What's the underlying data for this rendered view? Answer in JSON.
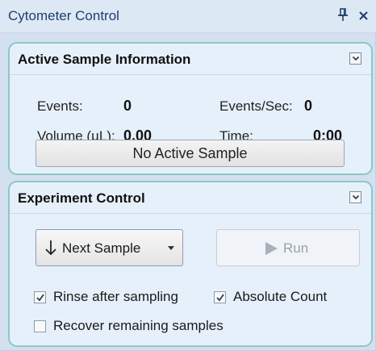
{
  "window": {
    "title": "Cytometer Control",
    "pin_icon": "pin-icon",
    "close_icon": "close-icon"
  },
  "active_sample": {
    "title": "Active Sample Information",
    "events_label": "Events:",
    "events_value": "0",
    "events_per_sec_label": "Events/Sec:",
    "events_per_sec_value": "0",
    "volume_label": "Volume (µL):",
    "volume_value": "0.00",
    "time_label": "Time:",
    "time_value": "0:00",
    "status_button_label": "No Active Sample"
  },
  "experiment_control": {
    "title": "Experiment Control",
    "next_sample_label": "Next Sample",
    "run_label": "Run",
    "run_enabled": false,
    "checkboxes": [
      {
        "label": "Rinse after sampling",
        "checked": true
      },
      {
        "label": "Absolute Count",
        "checked": true
      },
      {
        "label": "Recover remaining samples",
        "checked": false
      }
    ]
  },
  "colors": {
    "panel_bg": "#d3e0f0",
    "group_border": "#8cc8c4",
    "group_bg": "#e6f0fa",
    "title_text": "#1e3f6b",
    "disabled_text": "#9aa2ad"
  }
}
